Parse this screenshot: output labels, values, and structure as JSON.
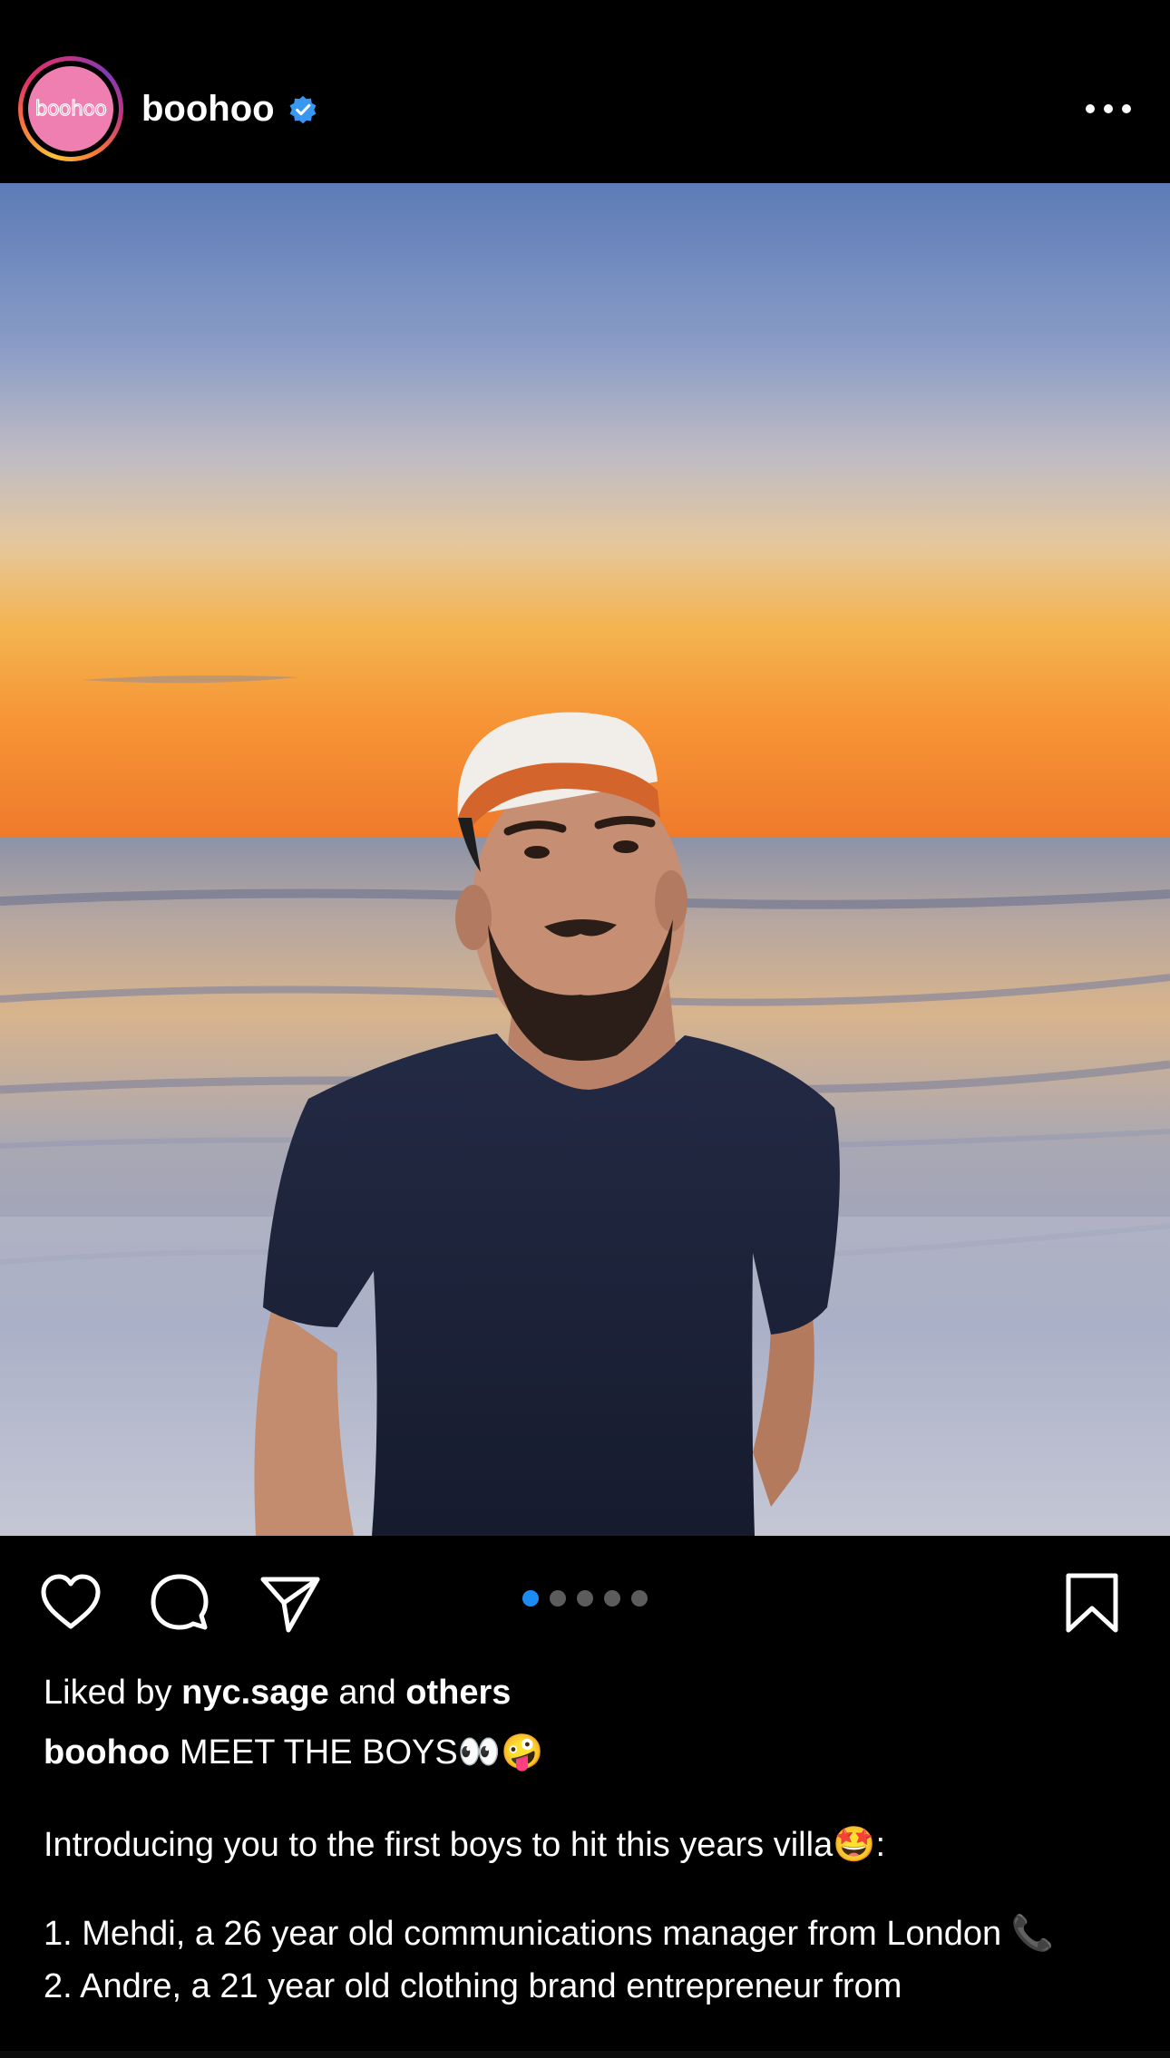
{
  "post": {
    "username": "boohoo",
    "avatar_text": "boohoo",
    "verified_icon": "verified-badge-icon",
    "more_icon": "more-options-icon",
    "verified_color": "#3897f0"
  },
  "photo": {
    "description_icon": "beach-sunset-photo"
  },
  "actions": {
    "like_icon": "heart-icon",
    "comment_icon": "comment-bubble-icon",
    "share_icon": "paper-plane-icon",
    "save_icon": "bookmark-icon",
    "carousel_count": 5,
    "carousel_active_index": 0,
    "active_dot_color": "#1d8cf2"
  },
  "likes": {
    "prefix": "Liked by",
    "user": "nyc.sage",
    "connector": "and",
    "others": "others"
  },
  "caption": {
    "username": "boohoo",
    "headline": "MEET THE BOYS👀🤪",
    "intro": "Introducing you to the first boys to hit this years villa🤩:",
    "item1": "1. Mehdi, a 26 year old communications manager from London 📞",
    "item2": "2. Andre, a 21 year old clothing brand entrepreneur from"
  }
}
